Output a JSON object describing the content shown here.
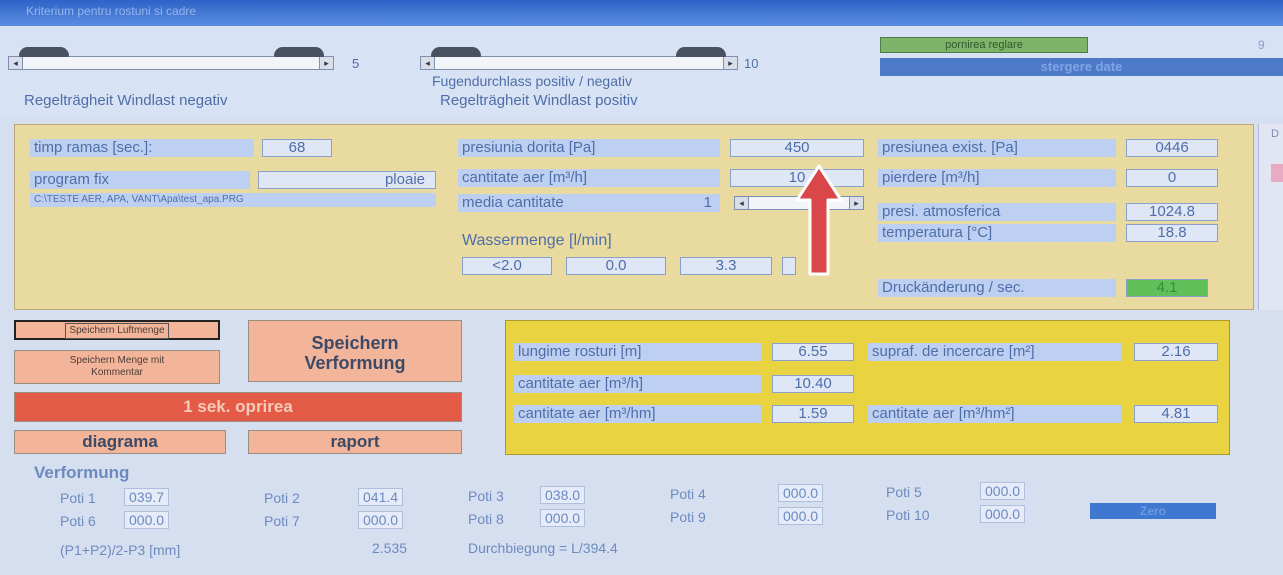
{
  "window": {
    "caption": "Kriterium pentru rostuni si cadre"
  },
  "top": {
    "slider1": {
      "max": "5",
      "caption": "Regelträgheit Windlast negativ"
    },
    "slider2": {
      "max": "10",
      "caption_line1": "Fugendurchlass positiv / negativ",
      "caption_line2": "Regelträgheit Windlast positiv"
    },
    "green_button": "pornirea reglare",
    "blue_bar": "stergere date",
    "right_number": "9"
  },
  "measure": {
    "timp_ramas_label": "timp ramas [sec.]:",
    "timp_ramas_value": "68",
    "program_label": "program fix",
    "program_value": "ploaie",
    "path": "C:\\TESTE AER, APA, VANT\\Apa\\test_apa.PRG",
    "presiunia_dorita_label": "presiunia dorita [Pa]",
    "presiunia_dorita_value": "450",
    "cantitate_aer_label": "cantitate aer [m³/h]",
    "cantitate_aer_value": "10",
    "media_label": "media cantitate",
    "media_value": "1",
    "wassermenge_label": "Wassermenge [l/min]",
    "wassermenge_values": [
      "<2.0",
      "0.0",
      "3.3"
    ],
    "presiunea_exist_label": "presiunea exist. [Pa]",
    "presiunea_exist_value": "0446",
    "pierdere_label": "pierdere [m³/h]",
    "pierdere_value": "0",
    "presi_atm_label": "presi. atmosferica",
    "presi_atm_value": "1024.8",
    "temperatura_label": "temperatura [°C]",
    "temperatura_value": "18.8",
    "druck_label": "Druckänderung / sec.",
    "druck_value": "4.1"
  },
  "buttons": {
    "speichern_luftmenge": "Speichern Luftmenge",
    "speichern_menge_line1": "Speichern Menge mit",
    "speichern_menge_line2": "Kommentar",
    "speichern_verformung_line1": "Speichern",
    "speichern_verformung_line2": "Verformung",
    "stop": "1 sek. oprirea",
    "diagrama": "diagrama",
    "raport": "raport",
    "zero": "Zero"
  },
  "results": {
    "lungime_label": "lungime rosturi [m]",
    "lungime_value": "6.55",
    "supraf_label": "supraf. de incercare [m²]",
    "supraf_value": "2.16",
    "cant_aer_h_label": "cantitate aer [m³/h]",
    "cant_aer_h_value": "10.40",
    "cant_aer_hm_label": "cantitate aer [m³/hm]",
    "cant_aer_hm_value": "1.59",
    "cant_aer_hm2_label": "cantitate aer [m³/hm²]",
    "cant_aer_hm2_value": "4.81"
  },
  "verformung": {
    "title": "Verformung",
    "poti": [
      {
        "label": "Poti 1",
        "value": "039.7"
      },
      {
        "label": "Poti 2",
        "value": "041.4"
      },
      {
        "label": "Poti 3",
        "value": "038.0"
      },
      {
        "label": "Poti 4",
        "value": "000.0"
      },
      {
        "label": "Poti 5",
        "value": "000.0"
      },
      {
        "label": "Poti 6",
        "value": "000.0"
      },
      {
        "label": "Poti 7",
        "value": "000.0"
      },
      {
        "label": "Poti 8",
        "value": "000.0"
      },
      {
        "label": "Poti 9",
        "value": "000.0"
      },
      {
        "label": "Poti 10",
        "value": "000.0"
      }
    ],
    "formula_label": "(P1+P2)/2-P3 [mm]",
    "formula_value": "2.535",
    "durchbiegung": "Durchbiegung = L/394.4"
  },
  "colors": {
    "arrow": "#d9474a",
    "panel_yellow": "#ead341",
    "stop_red": "#e35a47"
  }
}
